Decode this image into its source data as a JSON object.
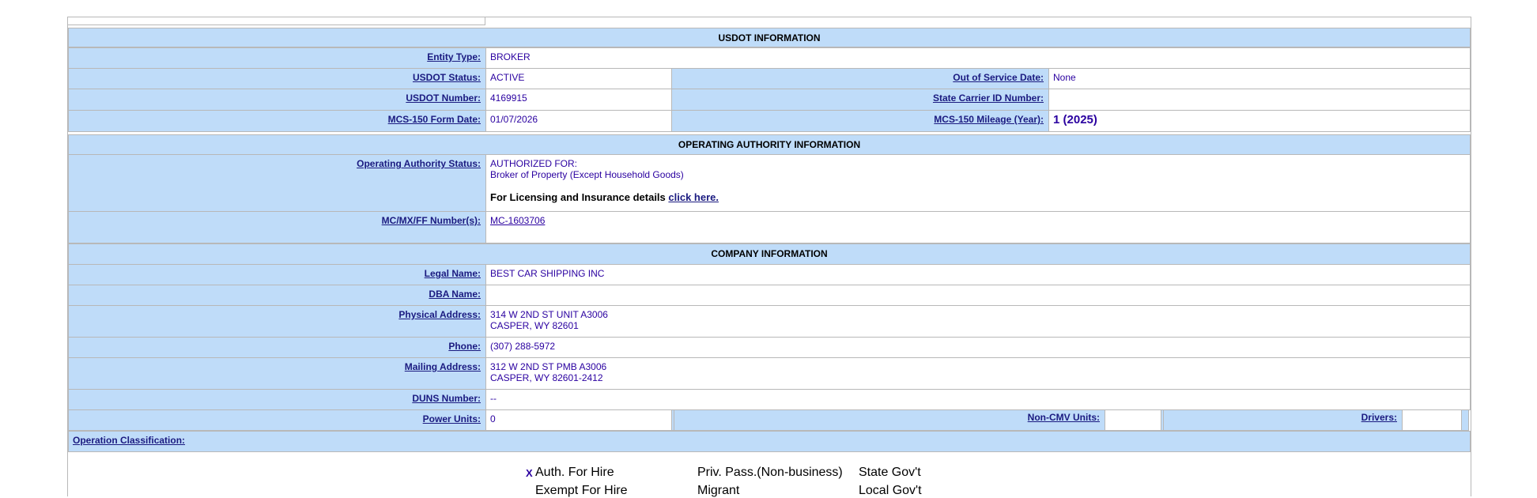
{
  "usdot_section": {
    "title": "USDOT INFORMATION",
    "entity_type": {
      "label": "Entity Type:",
      "value": "BROKER"
    },
    "usdot_status": {
      "label": "USDOT Status:",
      "value": "ACTIVE"
    },
    "out_of_service": {
      "label": "Out of Service Date:",
      "value": "None"
    },
    "usdot_number": {
      "label": "USDOT Number:",
      "value": "4169915"
    },
    "state_carrier_id": {
      "label": "State Carrier ID Number:",
      "value": ""
    },
    "mcs150_date": {
      "label": "MCS-150 Form Date:",
      "value": "01/07/2026"
    },
    "mcs150_mileage": {
      "label": "MCS-150 Mileage (Year):",
      "value": "1 (2025)"
    }
  },
  "authority_section": {
    "title": "OPERATING AUTHORITY INFORMATION",
    "status": {
      "label": "Operating Authority Status:",
      "line1": "AUTHORIZED FOR:",
      "line2": "Broker of Property (Except Household Goods)",
      "licensing_text": "For Licensing and Insurance details",
      "licensing_link": "click here."
    },
    "mc_number": {
      "label": "MC/MX/FF Number(s):",
      "value": "MC-1603706"
    }
  },
  "company_section": {
    "title": "COMPANY INFORMATION",
    "legal_name": {
      "label": "Legal Name:",
      "value": "BEST CAR SHIPPING INC"
    },
    "dba_name": {
      "label": "DBA Name:",
      "value": ""
    },
    "physical_address": {
      "label": "Physical Address:",
      "line1": "314 W 2ND ST UNIT A3006",
      "line2": "CASPER, WY   82601"
    },
    "phone": {
      "label": "Phone:",
      "value": "(307) 288-5972"
    },
    "mailing_address": {
      "label": "Mailing Address:",
      "line1": "312 W 2ND ST PMB A3006",
      "line2": "CASPER, WY   82601-2412"
    },
    "duns_number": {
      "label": "DUNS Number:",
      "value": "--"
    },
    "power_units": {
      "label": "Power Units:",
      "value": "0"
    },
    "non_cmv_units": {
      "label": "Non-CMV Units:",
      "value": ""
    },
    "drivers": {
      "label": "Drivers:",
      "value": ""
    }
  },
  "operation_classification": {
    "label": "Operation Classification:",
    "checked_mark": "X",
    "items": {
      "auth_for_hire": "Auth. For Hire",
      "exempt_for_hire": "Exempt For Hire",
      "priv_pass_nonbusiness": "Priv. Pass.(Non-business)",
      "migrant": "Migrant",
      "state_govt": "State Gov't",
      "local_govt": "Local Gov't"
    }
  }
}
